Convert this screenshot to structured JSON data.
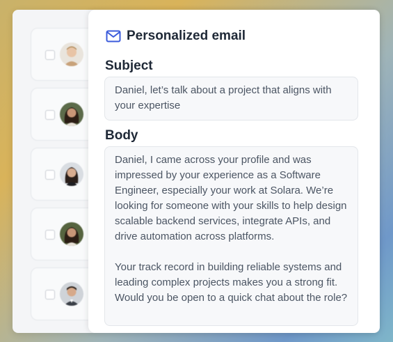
{
  "email_panel": {
    "title": "Personalized email",
    "icon": "mail-icon",
    "subject_label": "Subject",
    "subject_value": "Daniel, let’s talk about a project that aligns with your expertise",
    "body_label": "Body",
    "body_value": "Daniel, I came across your profile and was impressed by your experience as a Software Engineer, especially your work at Solara. We’re looking for someone with your skills to help design scalable backend services, integrate APIs, and drive automation across platforms.\n\nYour track record in building reliable systems and leading complex projects makes you a strong fit. Would you be open to a quick chat about the role?"
  },
  "candidates": [
    {
      "checked": false,
      "avatar": "avatar-man-light-hair"
    },
    {
      "checked": false,
      "avatar": "avatar-woman-dark-hair"
    },
    {
      "checked": false,
      "avatar": "avatar-woman-dark-hair"
    },
    {
      "checked": false,
      "avatar": "avatar-woman-dark-hair"
    },
    {
      "checked": false,
      "avatar": "avatar-man-dark-hair"
    }
  ],
  "colors": {
    "accent": "#3b5bdb",
    "panel_bg": "#ffffff",
    "field_bg": "#f7f8fa"
  }
}
